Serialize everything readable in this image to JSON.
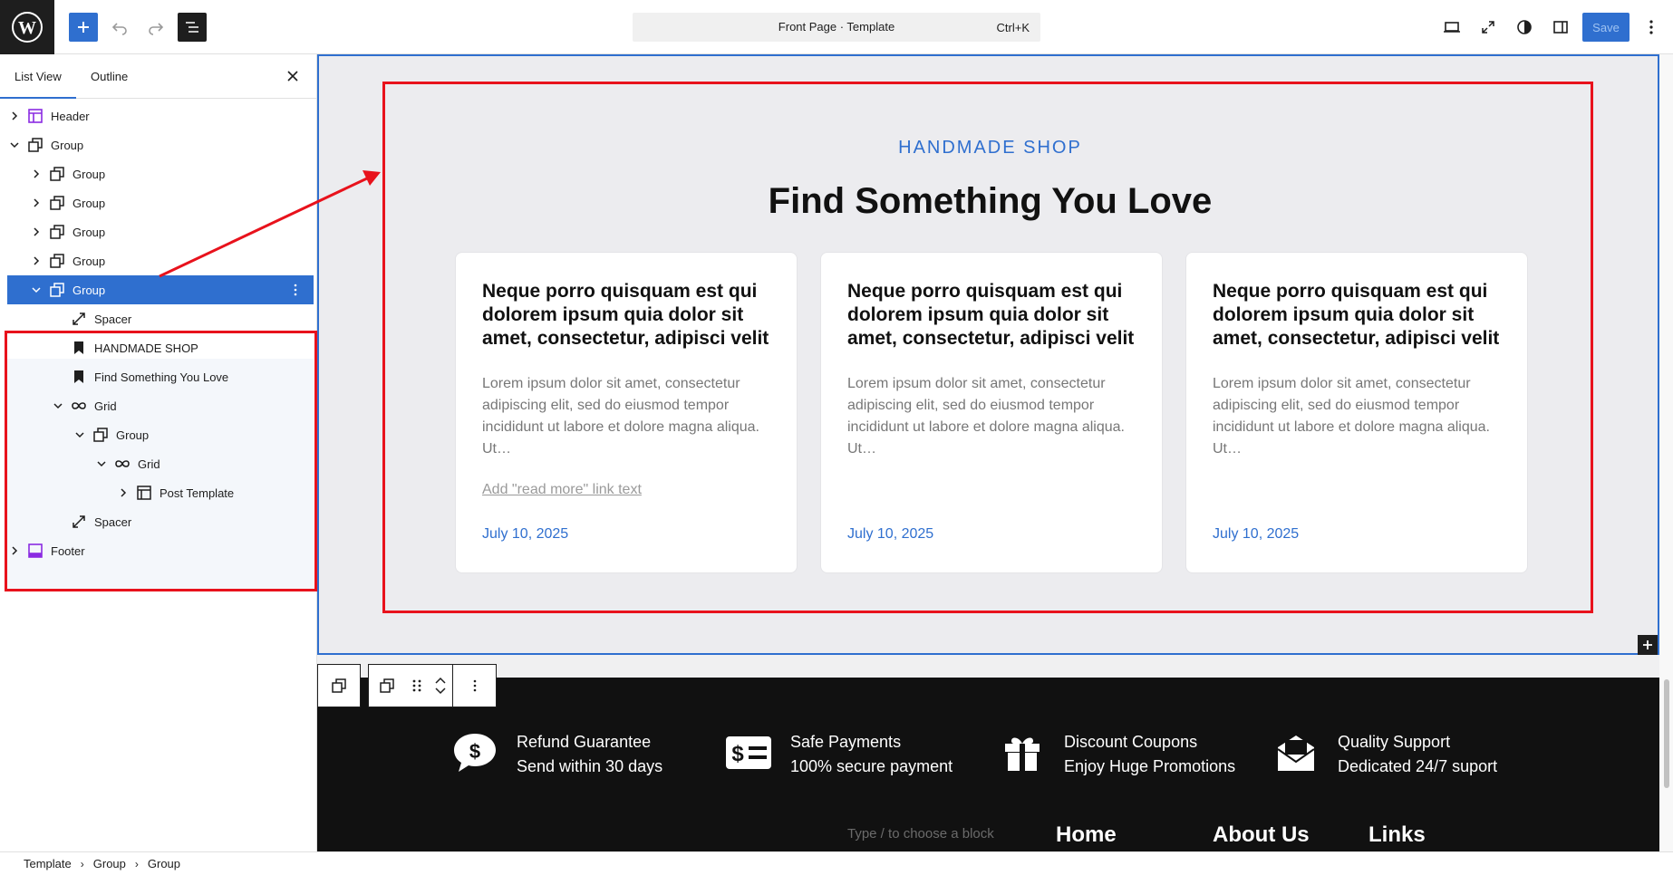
{
  "toolbar": {
    "document_title": "Front Page · Template",
    "shortcut": "Ctrl+K",
    "save_label": "Save"
  },
  "sidebar": {
    "tabs": [
      "List View",
      "Outline"
    ],
    "items": [
      {
        "label": "Header",
        "icon": "template-part-header-icon"
      },
      {
        "label": "Group",
        "icon": "group-icon"
      },
      {
        "label": "Group",
        "icon": "group-icon"
      },
      {
        "label": "Group",
        "icon": "group-icon"
      },
      {
        "label": "Group",
        "icon": "group-icon"
      },
      {
        "label": "Group",
        "icon": "group-icon"
      },
      {
        "label": "Group",
        "icon": "group-icon",
        "selected": true
      },
      {
        "label": "Spacer",
        "icon": "spacer-icon"
      },
      {
        "label": "HANDMADE SHOP",
        "icon": "bookmark-icon"
      },
      {
        "label": "Find Something You Love",
        "icon": "bookmark-icon"
      },
      {
        "label": "Grid",
        "icon": "query-loop-icon"
      },
      {
        "label": "Group",
        "icon": "group-icon"
      },
      {
        "label": "Grid",
        "icon": "query-loop-icon"
      },
      {
        "label": "Post Template",
        "icon": "layout-icon"
      },
      {
        "label": "Spacer",
        "icon": "spacer-icon"
      },
      {
        "label": "Footer",
        "icon": "template-part-footer-icon"
      }
    ]
  },
  "breadcrumb": [
    "Template",
    "Group",
    "Group"
  ],
  "canvas": {
    "eyebrow": "HANDMADE SHOP",
    "heading": "Find Something You Love",
    "cards": [
      {
        "title": "Neque porro quisquam est qui dolorem ipsum quia dolor sit amet, consectetur, adipisci velit",
        "excerpt": "Lorem ipsum dolor sit amet, consectetur adipiscing elit, sed do eiusmod tempor incididunt ut labore et dolore magna aliqua. Ut…",
        "read_more": "Add \"read more\" link text",
        "date": "July 10, 2025"
      },
      {
        "title": "Neque porro quisquam est qui dolorem ipsum quia dolor sit amet, consectetur, adipisci velit",
        "excerpt": "Lorem ipsum dolor sit amet, consectetur adipiscing elit, sed do eiusmod tempor incididunt ut labore et dolore magna aliqua. Ut…",
        "date": "July 10, 2025"
      },
      {
        "title": "Neque porro quisquam est qui dolorem ipsum quia dolor sit amet, consectetur, adipisci velit",
        "excerpt": "Lorem ipsum dolor sit amet, consectetur adipiscing elit, sed do eiusmod tempor incididunt ut labore et dolore magna aliqua. Ut…",
        "date": "July 10, 2025"
      }
    ],
    "features": [
      {
        "title": "Refund Guarantee",
        "subtitle": "Send within 30 days",
        "icon": "dollar-chat-icon"
      },
      {
        "title": "Safe Payments",
        "subtitle": "100% secure payment",
        "icon": "payment-card-icon"
      },
      {
        "title": "Discount Coupons",
        "subtitle": "Enjoy Huge Promotions",
        "icon": "gift-icon"
      },
      {
        "title": "Quality Support",
        "subtitle": "Dedicated 24/7 suport",
        "icon": "envelope-icon"
      }
    ],
    "footer_peek": {
      "hint": "Type / to choose a block",
      "links": [
        "Home",
        "About Us",
        "Links"
      ]
    }
  },
  "colors": {
    "accent": "#2f6fcf",
    "annotation": "#e8121c",
    "footer_bg": "#111111"
  }
}
